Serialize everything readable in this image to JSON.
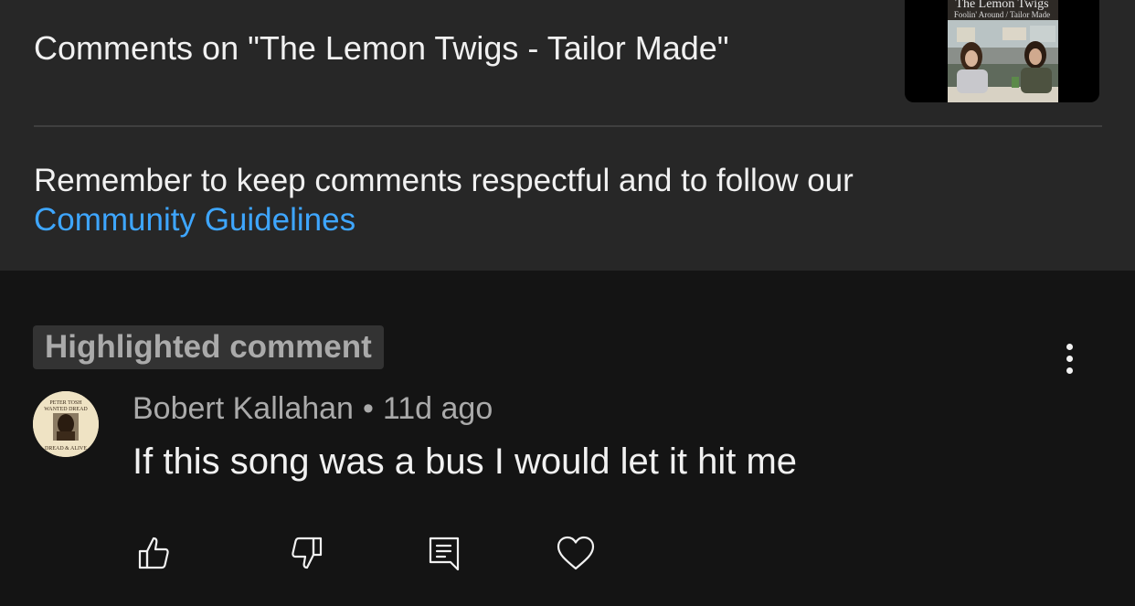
{
  "header": {
    "title": "Comments on \"The Lemon Twigs - Tailor Made\"",
    "thumbnail": {
      "band": "The Lemon Twigs",
      "songs": "Foolin' Around / Tailor Made"
    }
  },
  "notice": {
    "text": "Remember to keep comments respectful and to follow our",
    "link_label": "Community Guidelines"
  },
  "comment": {
    "badge": "Highlighted comment",
    "author": "Bobert Kallahan",
    "separator": "•",
    "time": "11d ago",
    "text": "If this song was a bus I would let it hit me",
    "avatar_text_top": "PETER TOSH",
    "avatar_text_mid": "WANTED DREAD",
    "avatar_text_bottom": "DREAD & ALIVE"
  },
  "actions": {
    "like_icon": "thumbs-up-icon",
    "dislike_icon": "thumbs-down-icon",
    "reply_icon": "reply-icon",
    "heart_icon": "heart-icon",
    "menu_icon": "more-vertical-icon"
  },
  "colors": {
    "background": "#141414",
    "panel": "#272727",
    "link": "#3ea6ff",
    "text_primary": "#f1f1f1",
    "text_secondary": "#aaaaaa"
  }
}
